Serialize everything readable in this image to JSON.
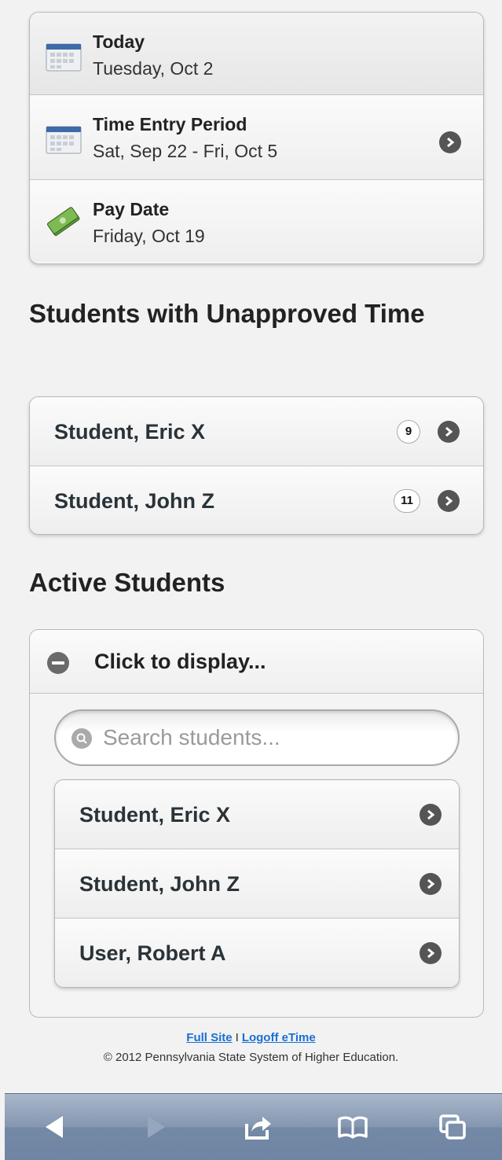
{
  "info_card": {
    "today": {
      "title": "Today",
      "value": "Tuesday, Oct 2"
    },
    "period": {
      "title": "Time Entry Period",
      "value": "Sat, Sep 22 - Fri, Oct 5"
    },
    "pay": {
      "title": "Pay Date",
      "value": "Friday, Oct 19"
    }
  },
  "unapproved": {
    "heading": "Students with Unapproved Time",
    "students": [
      {
        "name": "Student, Eric X",
        "count": "9"
      },
      {
        "name": "Student, John Z",
        "count": "11"
      }
    ]
  },
  "active": {
    "heading": "Active Students",
    "toggle_label": "Click to display...",
    "search_placeholder": "Search students...",
    "students": [
      {
        "name": "Student, Eric X"
      },
      {
        "name": "Student, John Z"
      },
      {
        "name": "User, Robert A"
      }
    ]
  },
  "footer": {
    "full_site": "Full Site",
    "separator": "I",
    "logoff": "Logoff eTime",
    "copyright": "© 2012 Pennsylvania State System of Higher Education."
  },
  "colors": {
    "toolbar": "#7489a6",
    "link": "#1a6fd1",
    "chevron": "#555555"
  }
}
